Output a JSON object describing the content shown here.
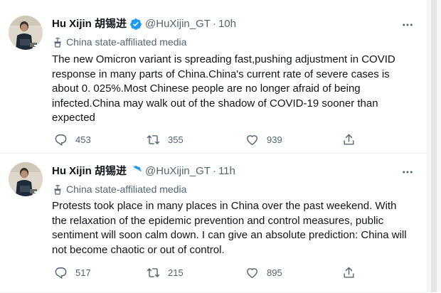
{
  "tweets": [
    {
      "name": "Hu Xijin 胡锡进",
      "handle": "@HuXijin_GT",
      "separator": "·",
      "time": "10h",
      "label": "China state-affiliated media",
      "text": "The new Omicron variant is spreading fast,pushing adjustment in COVID response in many parts of China.China's current rate of severe cases is about 0. 025%.Most Chinese people are no longer afraid of being infected.China may walk out of the shadow of COVID-19 sooner than expected",
      "replies": "453",
      "retweets": "355",
      "likes": "939"
    },
    {
      "name": "Hu Xijin 胡锡进",
      "handle": "@HuXijin_GT",
      "separator": "·",
      "time": "11h",
      "label": "China state-affiliated media",
      "text": "Protests took place in many places in China over the past weekend. With the relaxation of the epidemic prevention and control measures, public sentiment will soon calm down. I can give an absolute prediction: China will not become chaotic or out of control.",
      "replies": "517",
      "retweets": "215",
      "likes": "895"
    }
  ],
  "icons": {
    "verified": "verified-badge-icon",
    "label": "state-media-podium-icon",
    "reply": "reply-icon",
    "retweet": "retweet-icon",
    "like": "heart-icon",
    "share": "share-icon",
    "more": "more-icon"
  },
  "colors": {
    "verified": "#1d9bf0",
    "secondary_text": "#536471",
    "primary_text": "#0f1419"
  }
}
